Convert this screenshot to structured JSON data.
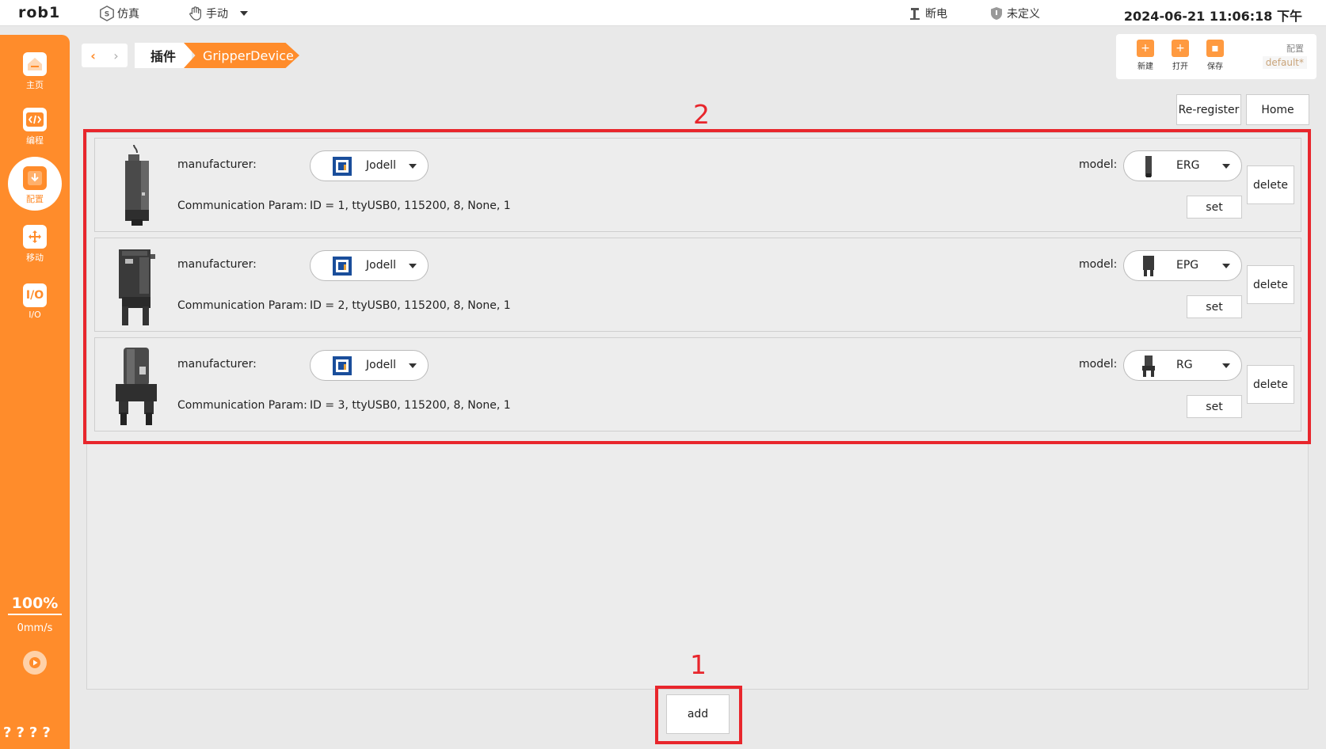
{
  "topbar": {
    "robot_name": "rob1",
    "mode_sim": "仿真",
    "mode_manual": "手动",
    "power": "断电",
    "safety": "未定义",
    "datetime": "2024-06-21 11:06:18 下午"
  },
  "sidebar": {
    "items": [
      {
        "label": "主页",
        "icon": "home-icon"
      },
      {
        "label": "编程",
        "icon": "code-icon"
      },
      {
        "label": "配置",
        "icon": "config-icon"
      },
      {
        "label": "移动",
        "icon": "move-icon"
      },
      {
        "label": "I/O",
        "icon": "io-icon"
      }
    ],
    "speed_percent": "100%",
    "speed_value": "0mm/s",
    "bottom_text": "????"
  },
  "breadcrumb": {
    "plugins": "插件",
    "device": "GripperDevice"
  },
  "file_panel": {
    "new": "新建",
    "open": "打开",
    "save": "保存",
    "config_label": "配置",
    "config_value": "default*"
  },
  "actions": {
    "reregister": "Re-register",
    "home": "Home",
    "add": "add"
  },
  "labels": {
    "manufacturer": "manufacturer:",
    "comm_param": "Communication Param:",
    "model": "model:",
    "delete": "delete",
    "set": "set"
  },
  "devices": [
    {
      "manufacturer": "Jodell",
      "model": "ERG",
      "comm": "ID = 1, ttyUSB0, 115200, 8, None, 1"
    },
    {
      "manufacturer": "Jodell",
      "model": "EPG",
      "comm": "ID = 2, ttyUSB0, 115200, 8, None, 1"
    },
    {
      "manufacturer": "Jodell",
      "model": "RG",
      "comm": "ID = 3, ttyUSB0, 115200, 8, None, 1"
    }
  ],
  "annotations": {
    "one": "1",
    "two": "2"
  },
  "colors": {
    "accent": "#ff8c2b",
    "highlight": "#e8262c",
    "brand_blue": "#1a4e9b"
  }
}
